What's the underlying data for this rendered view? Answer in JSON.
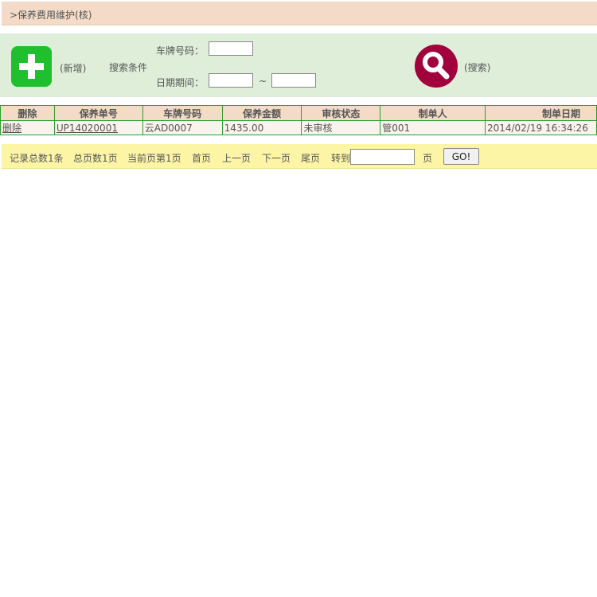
{
  "breadcrumb": {
    "text": ">保养费用维护(核)"
  },
  "search_panel": {
    "add_label": "(新增)",
    "conditions_label": "搜索条件",
    "plate_label": "车牌号码：",
    "plate_value": "",
    "date_label": "日期期间：",
    "date_from": "",
    "date_separator": "~",
    "date_to": "",
    "search_label": "(搜索)"
  },
  "table": {
    "headers": [
      "删除",
      "保养单号",
      "车牌号码",
      "保养金额",
      "审核状态",
      "制单人",
      "制单日期"
    ],
    "rows": [
      [
        "删除",
        "UP14020001",
        "云AD0007",
        "1435.00",
        "未审核",
        "管001",
        "2014/02/19 16:34:26"
      ]
    ]
  },
  "pager": {
    "total_records": "记录总数1条",
    "total_pages": "总页数1页",
    "current_page": "当前页第1页",
    "first": "首页",
    "prev": "上一页",
    "next": "下一页",
    "last": "尾页",
    "goto_label": "转到",
    "goto_value": "",
    "page_suffix": "页",
    "go_button": "GO!"
  },
  "colors": {
    "add_button": "#1fbf2d",
    "search_button": "#a1003c",
    "header_bg": "#f3dbc8",
    "panel_bg": "#deeed9",
    "pager_bg": "#fdf5a6",
    "grid_border": "#2aa02a"
  }
}
